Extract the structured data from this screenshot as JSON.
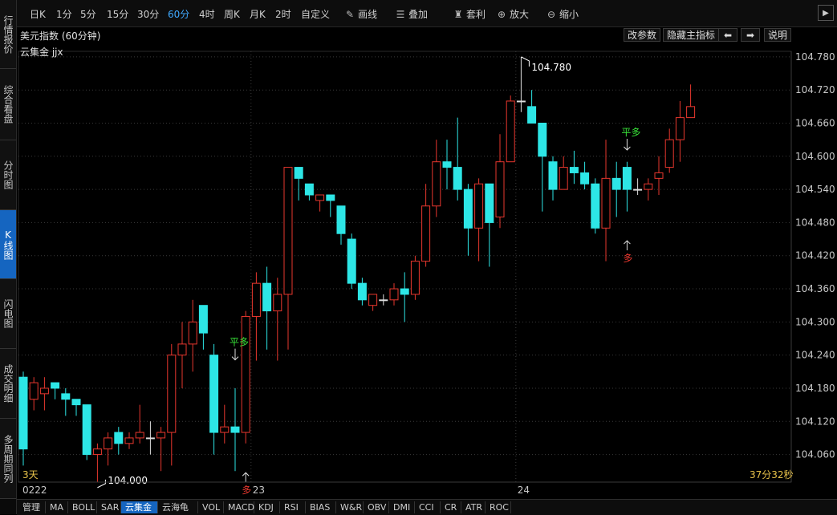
{
  "sidebar": {
    "tabs": [
      {
        "label": "行情报价",
        "active": false
      },
      {
        "label": "综合看盘",
        "active": false
      },
      {
        "label": "分时图",
        "active": false
      },
      {
        "label": "K线图",
        "active": true
      },
      {
        "label": "闪电图",
        "active": false
      },
      {
        "label": "成交明细",
        "active": false
      },
      {
        "label": "多周期同列",
        "active": false
      }
    ]
  },
  "toolbar": {
    "periods": [
      {
        "label": "日K",
        "active": false
      },
      {
        "label": "1分",
        "active": false
      },
      {
        "label": "5分",
        "active": false
      },
      {
        "label": "15分",
        "active": false
      },
      {
        "label": "30分",
        "active": false
      },
      {
        "label": "60分",
        "active": true
      },
      {
        "label": "4时",
        "active": false
      },
      {
        "label": "周K",
        "active": false
      },
      {
        "label": "月K",
        "active": false
      },
      {
        "label": "2时",
        "active": false
      },
      {
        "label": "自定义",
        "active": false
      }
    ],
    "tools": [
      {
        "label": "画线",
        "icon": "pencil-icon"
      },
      {
        "label": "叠加",
        "icon": "stack-icon"
      },
      {
        "label": "套利",
        "icon": "moneybag-icon"
      },
      {
        "label": "放大",
        "icon": "zoom-in-icon"
      },
      {
        "label": "缩小",
        "icon": "zoom-out-icon"
      }
    ]
  },
  "chart_header": {
    "title": "美元指数 (60分钟)",
    "indicator": "云集金 jjx",
    "buttons": {
      "params": "改参数",
      "hide": "隐藏主指标",
      "explain": "说明"
    }
  },
  "chart_data": {
    "type": "candlestick",
    "ylim": [
      104.01,
      104.79
    ],
    "yticks": [
      "104.780",
      "104.720",
      "104.660",
      "104.600",
      "104.540",
      "104.480",
      "104.420",
      "104.360",
      "104.300",
      "104.240",
      "104.180",
      "104.120",
      "104.060"
    ],
    "x_labels": [
      {
        "label": "0222",
        "index": 0
      },
      {
        "label": "23",
        "index": 22
      },
      {
        "label": "24",
        "index": 47
      }
    ],
    "colors": {
      "up": "#e8372e",
      "down": "#2de6e6"
    },
    "candles": [
      [
        104.2,
        104.07,
        104.21,
        104.04
      ],
      [
        104.16,
        104.19,
        104.2,
        104.14
      ],
      [
        104.17,
        104.18,
        104.2,
        104.14
      ],
      [
        104.19,
        104.18,
        104.19,
        104.16
      ],
      [
        104.17,
        104.16,
        104.18,
        104.13
      ],
      [
        104.16,
        104.15,
        104.16,
        104.13
      ],
      [
        104.15,
        104.06,
        104.15,
        104.05
      ],
      [
        104.06,
        104.07,
        104.08,
        104.01
      ],
      [
        104.07,
        104.09,
        104.1,
        104.04
      ],
      [
        104.1,
        104.08,
        104.11,
        104.06
      ],
      [
        104.08,
        104.09,
        104.1,
        104.07
      ],
      [
        104.09,
        104.1,
        104.15,
        104.08
      ],
      [
        104.09,
        104.09,
        104.12,
        104.06
      ],
      [
        104.09,
        104.1,
        104.11,
        104.03
      ],
      [
        104.1,
        104.24,
        104.26,
        104.04
      ],
      [
        104.24,
        104.26,
        104.3,
        104.18
      ],
      [
        104.26,
        104.3,
        104.34,
        104.21
      ],
      [
        104.33,
        104.28,
        104.33,
        104.25
      ],
      [
        104.24,
        104.1,
        104.26,
        104.06
      ],
      [
        104.1,
        104.11,
        104.15,
        104.08
      ],
      [
        104.11,
        104.1,
        104.18,
        104.03
      ],
      [
        104.1,
        104.31,
        104.32,
        104.08
      ],
      [
        104.31,
        104.37,
        104.39,
        104.23
      ],
      [
        104.37,
        104.32,
        104.4,
        104.25
      ],
      [
        104.32,
        104.35,
        104.38,
        104.23
      ],
      [
        104.35,
        104.58,
        104.58,
        104.25
      ],
      [
        104.58,
        104.56,
        104.58,
        104.52
      ],
      [
        104.55,
        104.53,
        104.55,
        104.52
      ],
      [
        104.52,
        104.53,
        104.53,
        104.5
      ],
      [
        104.53,
        104.52,
        104.53,
        104.49
      ],
      [
        104.51,
        104.46,
        104.51,
        104.44
      ],
      [
        104.45,
        104.37,
        104.46,
        104.36
      ],
      [
        104.37,
        104.34,
        104.38,
        104.33
      ],
      [
        104.33,
        104.35,
        104.35,
        104.32
      ],
      [
        104.34,
        104.34,
        104.35,
        104.33
      ],
      [
        104.34,
        104.36,
        104.37,
        104.33
      ],
      [
        104.36,
        104.35,
        104.39,
        104.3
      ],
      [
        104.35,
        104.41,
        104.42,
        104.34
      ],
      [
        104.41,
        104.51,
        104.55,
        104.4
      ],
      [
        104.51,
        104.59,
        104.63,
        104.49
      ],
      [
        104.59,
        104.58,
        104.63,
        104.54
      ],
      [
        104.58,
        104.54,
        104.67,
        104.52
      ],
      [
        104.54,
        104.47,
        104.55,
        104.42
      ],
      [
        104.47,
        104.55,
        104.56,
        104.41
      ],
      [
        104.55,
        104.48,
        104.55,
        104.4
      ],
      [
        104.49,
        104.59,
        104.64,
        104.47
      ],
      [
        104.59,
        104.7,
        104.71,
        104.59
      ],
      [
        104.7,
        104.7,
        104.78,
        104.68
      ],
      [
        104.69,
        104.66,
        104.72,
        104.66
      ],
      [
        104.66,
        104.6,
        104.66,
        104.5
      ],
      [
        104.59,
        104.54,
        104.6,
        104.52
      ],
      [
        104.54,
        104.58,
        104.6,
        104.54
      ],
      [
        104.58,
        104.57,
        104.61,
        104.55
      ],
      [
        104.57,
        104.55,
        104.59,
        104.54
      ],
      [
        104.55,
        104.47,
        104.56,
        104.46
      ],
      [
        104.47,
        104.56,
        104.63,
        104.41
      ],
      [
        104.56,
        104.54,
        104.59,
        104.49
      ],
      [
        104.58,
        104.54,
        104.59,
        104.5
      ],
      [
        104.54,
        104.54,
        104.56,
        104.53
      ],
      [
        104.54,
        104.55,
        104.56,
        104.52
      ],
      [
        104.56,
        104.57,
        104.6,
        104.53
      ],
      [
        104.58,
        104.63,
        104.65,
        104.57
      ],
      [
        104.63,
        104.67,
        104.7,
        104.59
      ],
      [
        104.67,
        104.69,
        104.73,
        104.67
      ]
    ],
    "annotations": [
      {
        "text": "104.780",
        "index": 47,
        "value": 104.78,
        "color": "#ffffff",
        "kind": "high"
      },
      {
        "text": "104.000",
        "index": 7,
        "value": 104.0,
        "color": "#ffffff",
        "kind": "low"
      },
      {
        "text": "平多",
        "index": 20,
        "value": 104.24,
        "color": "#38e238",
        "kind": "above"
      },
      {
        "text": "多",
        "index": 21,
        "value": 104.03,
        "color": "#e8372e",
        "kind": "below"
      },
      {
        "text": "平多",
        "index": 57,
        "value": 104.62,
        "color": "#38e238",
        "kind": "above"
      },
      {
        "text": "多",
        "index": 57,
        "value": 104.45,
        "color": "#e8372e",
        "kind": "below"
      }
    ],
    "bottom_left_label": "3天",
    "bottom_right_label": "37分32秒"
  },
  "bottombar": {
    "tabs": [
      {
        "label": "管理",
        "active": false
      },
      {
        "label": "MA",
        "active": false
      },
      {
        "label": "BOLL",
        "active": false
      },
      {
        "label": "SAR",
        "active": false
      },
      {
        "label": "云集金",
        "active": true
      },
      {
        "label": "云海龟",
        "active": false
      },
      {
        "label": "VOL",
        "active": false
      },
      {
        "label": "MACD",
        "active": false
      },
      {
        "label": "KDJ",
        "active": false
      },
      {
        "label": "RSI",
        "active": false
      },
      {
        "label": "BIAS",
        "active": false
      },
      {
        "label": "W&R",
        "active": false
      },
      {
        "label": "OBV",
        "active": false
      },
      {
        "label": "DMI",
        "active": false
      },
      {
        "label": "CCI",
        "active": false
      },
      {
        "label": "CR",
        "active": false
      },
      {
        "label": "ATR",
        "active": false
      },
      {
        "label": "ROC",
        "active": false
      }
    ]
  }
}
